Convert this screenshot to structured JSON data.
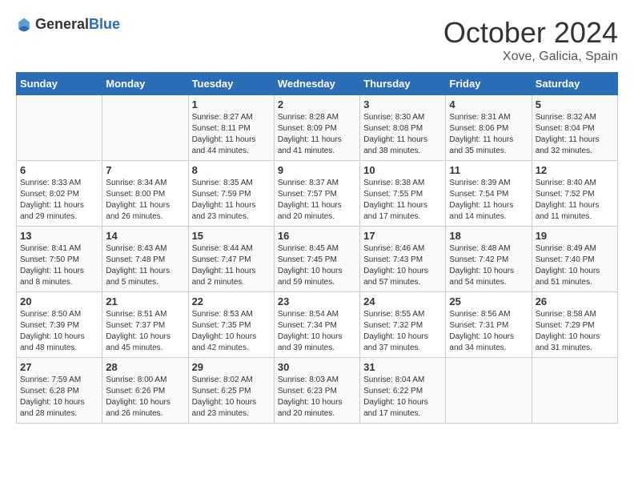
{
  "header": {
    "logo_general": "General",
    "logo_blue": "Blue",
    "month": "October 2024",
    "location": "Xove, Galicia, Spain"
  },
  "weekdays": [
    "Sunday",
    "Monday",
    "Tuesday",
    "Wednesday",
    "Thursday",
    "Friday",
    "Saturday"
  ],
  "weeks": [
    [
      null,
      null,
      {
        "day": 1,
        "sunrise": "8:27 AM",
        "sunset": "8:11 PM",
        "daylight": "11 hours and 44 minutes."
      },
      {
        "day": 2,
        "sunrise": "8:28 AM",
        "sunset": "8:09 PM",
        "daylight": "11 hours and 41 minutes."
      },
      {
        "day": 3,
        "sunrise": "8:30 AM",
        "sunset": "8:08 PM",
        "daylight": "11 hours and 38 minutes."
      },
      {
        "day": 4,
        "sunrise": "8:31 AM",
        "sunset": "8:06 PM",
        "daylight": "11 hours and 35 minutes."
      },
      {
        "day": 5,
        "sunrise": "8:32 AM",
        "sunset": "8:04 PM",
        "daylight": "11 hours and 32 minutes."
      }
    ],
    [
      {
        "day": 6,
        "sunrise": "8:33 AM",
        "sunset": "8:02 PM",
        "daylight": "11 hours and 29 minutes."
      },
      {
        "day": 7,
        "sunrise": "8:34 AM",
        "sunset": "8:00 PM",
        "daylight": "11 hours and 26 minutes."
      },
      {
        "day": 8,
        "sunrise": "8:35 AM",
        "sunset": "7:59 PM",
        "daylight": "11 hours and 23 minutes."
      },
      {
        "day": 9,
        "sunrise": "8:37 AM",
        "sunset": "7:57 PM",
        "daylight": "11 hours and 20 minutes."
      },
      {
        "day": 10,
        "sunrise": "8:38 AM",
        "sunset": "7:55 PM",
        "daylight": "11 hours and 17 minutes."
      },
      {
        "day": 11,
        "sunrise": "8:39 AM",
        "sunset": "7:54 PM",
        "daylight": "11 hours and 14 minutes."
      },
      {
        "day": 12,
        "sunrise": "8:40 AM",
        "sunset": "7:52 PM",
        "daylight": "11 hours and 11 minutes."
      }
    ],
    [
      {
        "day": 13,
        "sunrise": "8:41 AM",
        "sunset": "7:50 PM",
        "daylight": "11 hours and 8 minutes."
      },
      {
        "day": 14,
        "sunrise": "8:43 AM",
        "sunset": "7:48 PM",
        "daylight": "11 hours and 5 minutes."
      },
      {
        "day": 15,
        "sunrise": "8:44 AM",
        "sunset": "7:47 PM",
        "daylight": "11 hours and 2 minutes."
      },
      {
        "day": 16,
        "sunrise": "8:45 AM",
        "sunset": "7:45 PM",
        "daylight": "10 hours and 59 minutes."
      },
      {
        "day": 17,
        "sunrise": "8:46 AM",
        "sunset": "7:43 PM",
        "daylight": "10 hours and 57 minutes."
      },
      {
        "day": 18,
        "sunrise": "8:48 AM",
        "sunset": "7:42 PM",
        "daylight": "10 hours and 54 minutes."
      },
      {
        "day": 19,
        "sunrise": "8:49 AM",
        "sunset": "7:40 PM",
        "daylight": "10 hours and 51 minutes."
      }
    ],
    [
      {
        "day": 20,
        "sunrise": "8:50 AM",
        "sunset": "7:39 PM",
        "daylight": "10 hours and 48 minutes."
      },
      {
        "day": 21,
        "sunrise": "8:51 AM",
        "sunset": "7:37 PM",
        "daylight": "10 hours and 45 minutes."
      },
      {
        "day": 22,
        "sunrise": "8:53 AM",
        "sunset": "7:35 PM",
        "daylight": "10 hours and 42 minutes."
      },
      {
        "day": 23,
        "sunrise": "8:54 AM",
        "sunset": "7:34 PM",
        "daylight": "10 hours and 39 minutes."
      },
      {
        "day": 24,
        "sunrise": "8:55 AM",
        "sunset": "7:32 PM",
        "daylight": "10 hours and 37 minutes."
      },
      {
        "day": 25,
        "sunrise": "8:56 AM",
        "sunset": "7:31 PM",
        "daylight": "10 hours and 34 minutes."
      },
      {
        "day": 26,
        "sunrise": "8:58 AM",
        "sunset": "7:29 PM",
        "daylight": "10 hours and 31 minutes."
      }
    ],
    [
      {
        "day": 27,
        "sunrise": "7:59 AM",
        "sunset": "6:28 PM",
        "daylight": "10 hours and 28 minutes."
      },
      {
        "day": 28,
        "sunrise": "8:00 AM",
        "sunset": "6:26 PM",
        "daylight": "10 hours and 26 minutes."
      },
      {
        "day": 29,
        "sunrise": "8:02 AM",
        "sunset": "6:25 PM",
        "daylight": "10 hours and 23 minutes."
      },
      {
        "day": 30,
        "sunrise": "8:03 AM",
        "sunset": "6:23 PM",
        "daylight": "10 hours and 20 minutes."
      },
      {
        "day": 31,
        "sunrise": "8:04 AM",
        "sunset": "6:22 PM",
        "daylight": "10 hours and 17 minutes."
      },
      null,
      null
    ]
  ]
}
